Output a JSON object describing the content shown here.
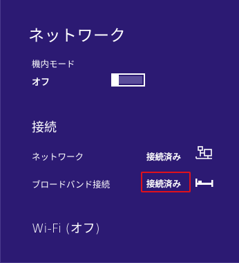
{
  "title": "ネットワーク",
  "airplane": {
    "label": "機内モード",
    "state": "オフ",
    "toggle_on": false
  },
  "connections": {
    "heading": "接続",
    "items": [
      {
        "name": "ネットワーク",
        "status": "接続済み",
        "icon": "wired-network-icon"
      },
      {
        "name": "ブロードバンド接続",
        "status": "接続済み",
        "icon": "broadband-bed-icon"
      }
    ]
  },
  "wifi": {
    "heading": "Wi-Fi (オフ)"
  },
  "colors": {
    "background": "#2c1a73",
    "text": "#ffffff",
    "toggle_track": "#5b4d9a",
    "highlight": "#e0111b"
  }
}
